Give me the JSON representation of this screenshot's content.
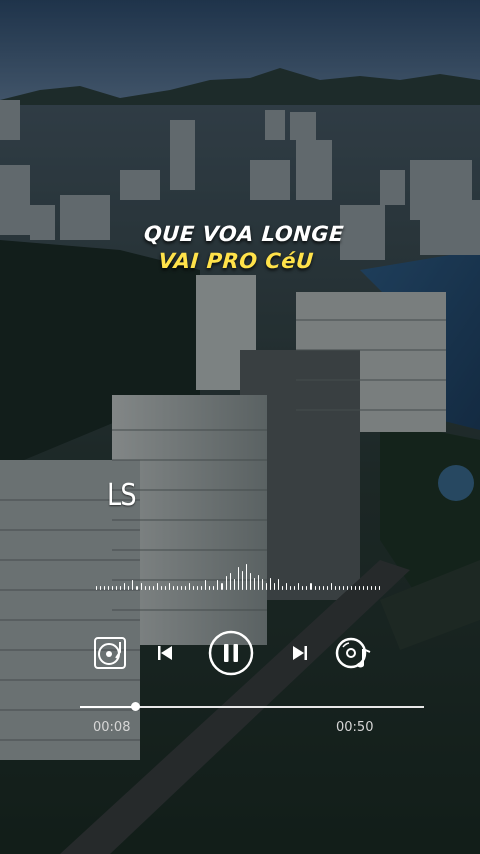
{
  "lyrics": {
    "line1": "QUE VOA LONGE",
    "line2": "VAI PRO CéU",
    "line1_color": "#ffffff",
    "line2_color": "#ffe24a"
  },
  "watermark": "LS",
  "player": {
    "elapsed": "00:08",
    "total": "00:50",
    "progress_fraction": 0.16,
    "state": "playing",
    "buttons": [
      "vinyl-player-icon",
      "previous-track-icon",
      "pause-icon",
      "next-track-icon",
      "music-disc-icon"
    ]
  },
  "waveform": {
    "levels": [
      0.12,
      0.12,
      0.12,
      0.12,
      0.12,
      0.12,
      0.12,
      0.22,
      0.12,
      0.32,
      0.12,
      0.22,
      0.12,
      0.12,
      0.12,
      0.22,
      0.12,
      0.12,
      0.22,
      0.12,
      0.12,
      0.12,
      0.12,
      0.22,
      0.12,
      0.12,
      0.12,
      0.32,
      0.12,
      0.12,
      0.32,
      0.22,
      0.45,
      0.55,
      0.35,
      0.78,
      0.62,
      0.85,
      0.55,
      0.4,
      0.5,
      0.35,
      0.22,
      0.4,
      0.22,
      0.35,
      0.12,
      0.22,
      0.12,
      0.12,
      0.22,
      0.12,
      0.12,
      0.22,
      0.12,
      0.12,
      0.12,
      0.12,
      0.22,
      0.12,
      0.12,
      0.12,
      0.12,
      0.12,
      0.12,
      0.12,
      0.12,
      0.12,
      0.12,
      0.12,
      0.12
    ]
  }
}
